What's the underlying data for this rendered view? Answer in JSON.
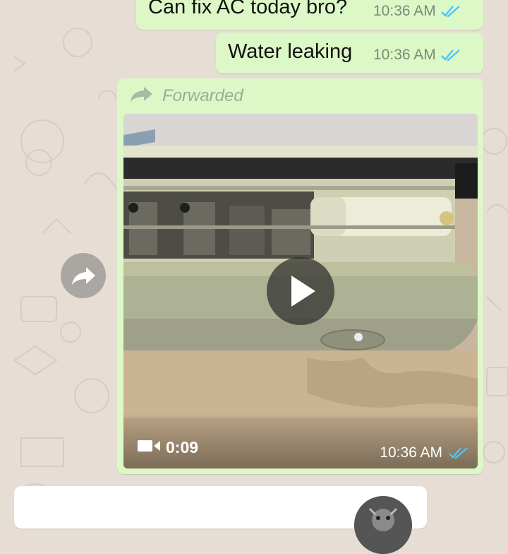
{
  "colors": {
    "wallpaper": "#e6ddd4",
    "outgoing_bubble": "#dcf8c6",
    "incoming_bubble": "#ffffff",
    "read_ticks": "#4fc3f7",
    "forwarded_label": "#9cac97"
  },
  "messages": [
    {
      "text": "Can fix AC today bro?",
      "time": "10:36 AM",
      "status": "read"
    },
    {
      "text": "Water leaking",
      "time": "10:36 AM",
      "status": "read"
    }
  ],
  "video_message": {
    "forwarded_label": "Forwarded",
    "forwarded_icon": "forward-arrow-icon",
    "duration": "0:09",
    "time": "10:36 AM",
    "status": "read",
    "play_icon": "play-icon",
    "camera_icon": "video-camera-icon"
  },
  "share_button": {
    "icon": "share-forward-icon"
  },
  "incoming_partial": {
    "avatar_icon": "avatar-icon"
  }
}
